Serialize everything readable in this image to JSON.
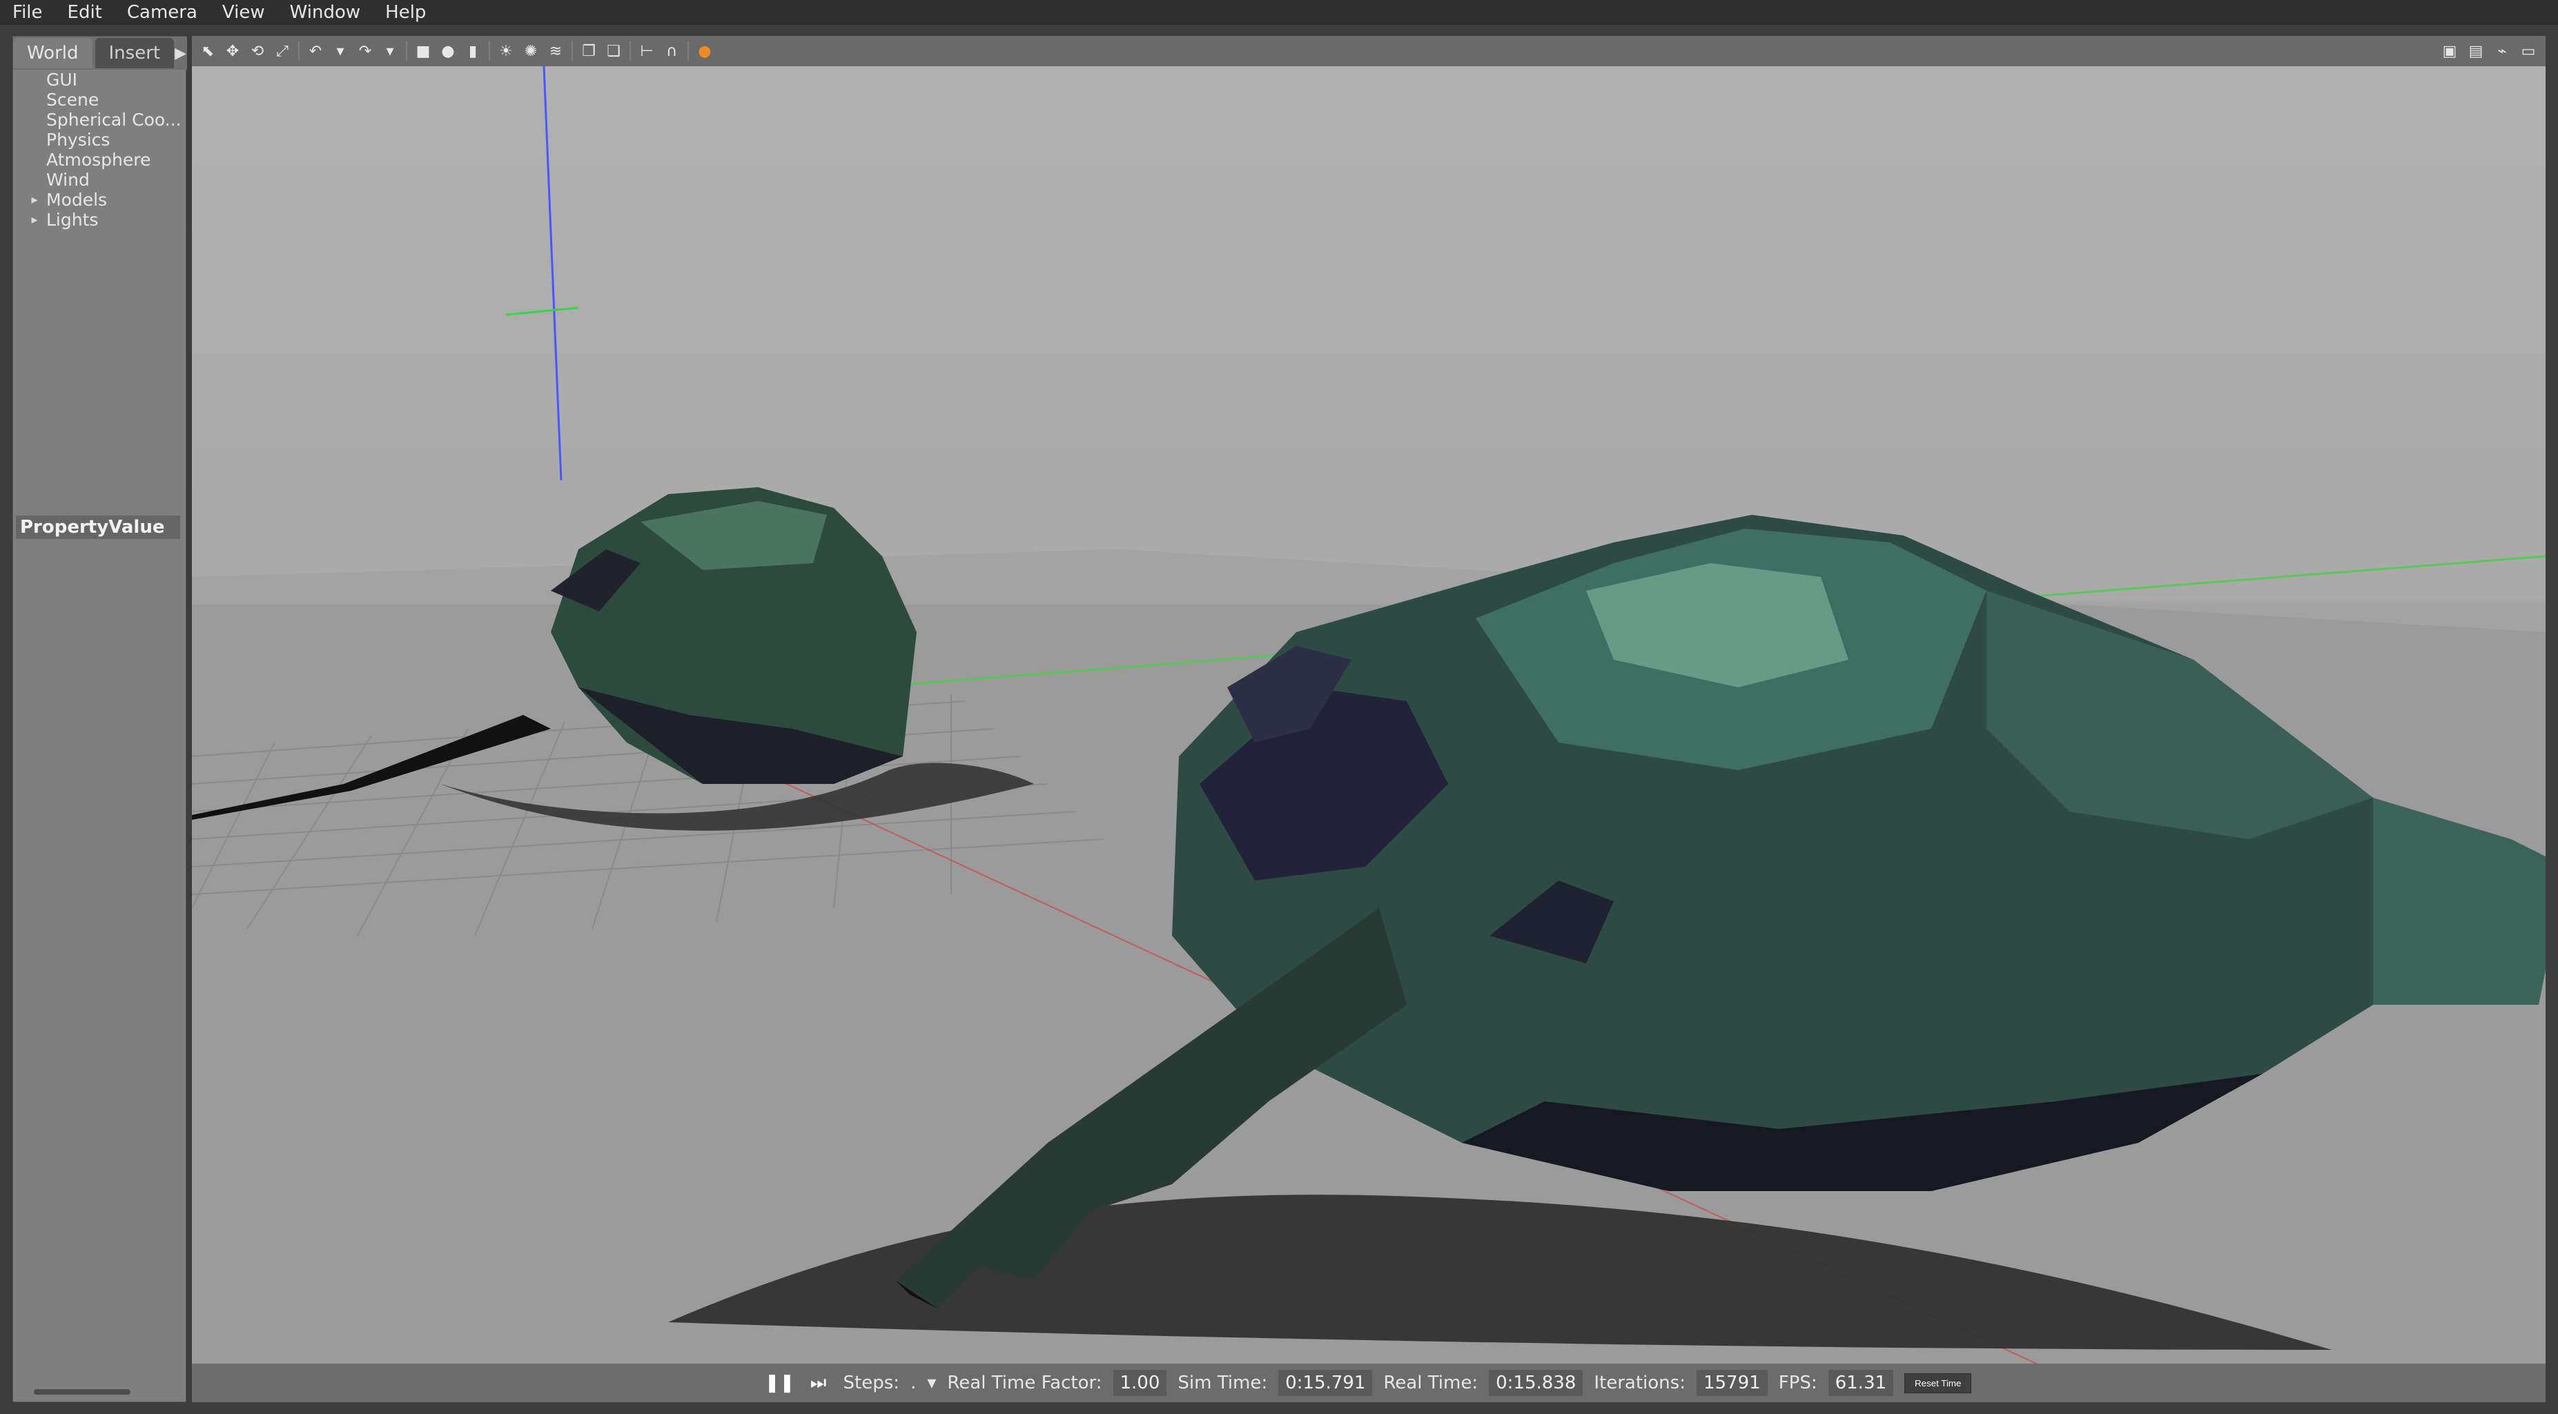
{
  "menu": [
    "File",
    "Edit",
    "Camera",
    "View",
    "Window",
    "Help"
  ],
  "left_panel": {
    "tabs": [
      "World",
      "Insert"
    ],
    "tree": [
      {
        "label": "GUI",
        "expandable": false
      },
      {
        "label": "Scene",
        "expandable": false
      },
      {
        "label": "Spherical Coo...",
        "expandable": false
      },
      {
        "label": "Physics",
        "expandable": false
      },
      {
        "label": "Atmosphere",
        "expandable": false
      },
      {
        "label": "Wind",
        "expandable": false
      },
      {
        "label": "Models",
        "expandable": true
      },
      {
        "label": "Lights",
        "expandable": true
      }
    ],
    "property_header": "PropertyValue"
  },
  "toolbar": {
    "icons_left": [
      "select-icon",
      "move-icon",
      "rotate-icon",
      "scale-icon",
      "undo-icon",
      "undo-arrow-icon",
      "redo-icon",
      "redo-arrow-icon",
      "box-shape-icon",
      "sphere-shape-icon",
      "cylinder-shape-icon",
      "sun-light-icon",
      "point-light-icon",
      "spot-light-icon",
      "copy-icon",
      "paste-icon",
      "align-icon",
      "snap-icon",
      "record-icon"
    ],
    "icons_right": [
      "screenshot-icon",
      "log-icon",
      "plot-icon",
      "video-icon"
    ]
  },
  "status": {
    "steps_label": "Steps:",
    "steps_value": ".",
    "rtf_label": "Real Time Factor:",
    "rtf_value": "1.00",
    "sim_label": "Sim Time:",
    "sim_value": "0:15.791",
    "real_label": "Real Time:",
    "real_value": "0:15.838",
    "iter_label": "Iterations:",
    "iter_value": "15791",
    "fps_label": "FPS:",
    "fps_value": "61.31",
    "reset_label": "Reset Time"
  }
}
